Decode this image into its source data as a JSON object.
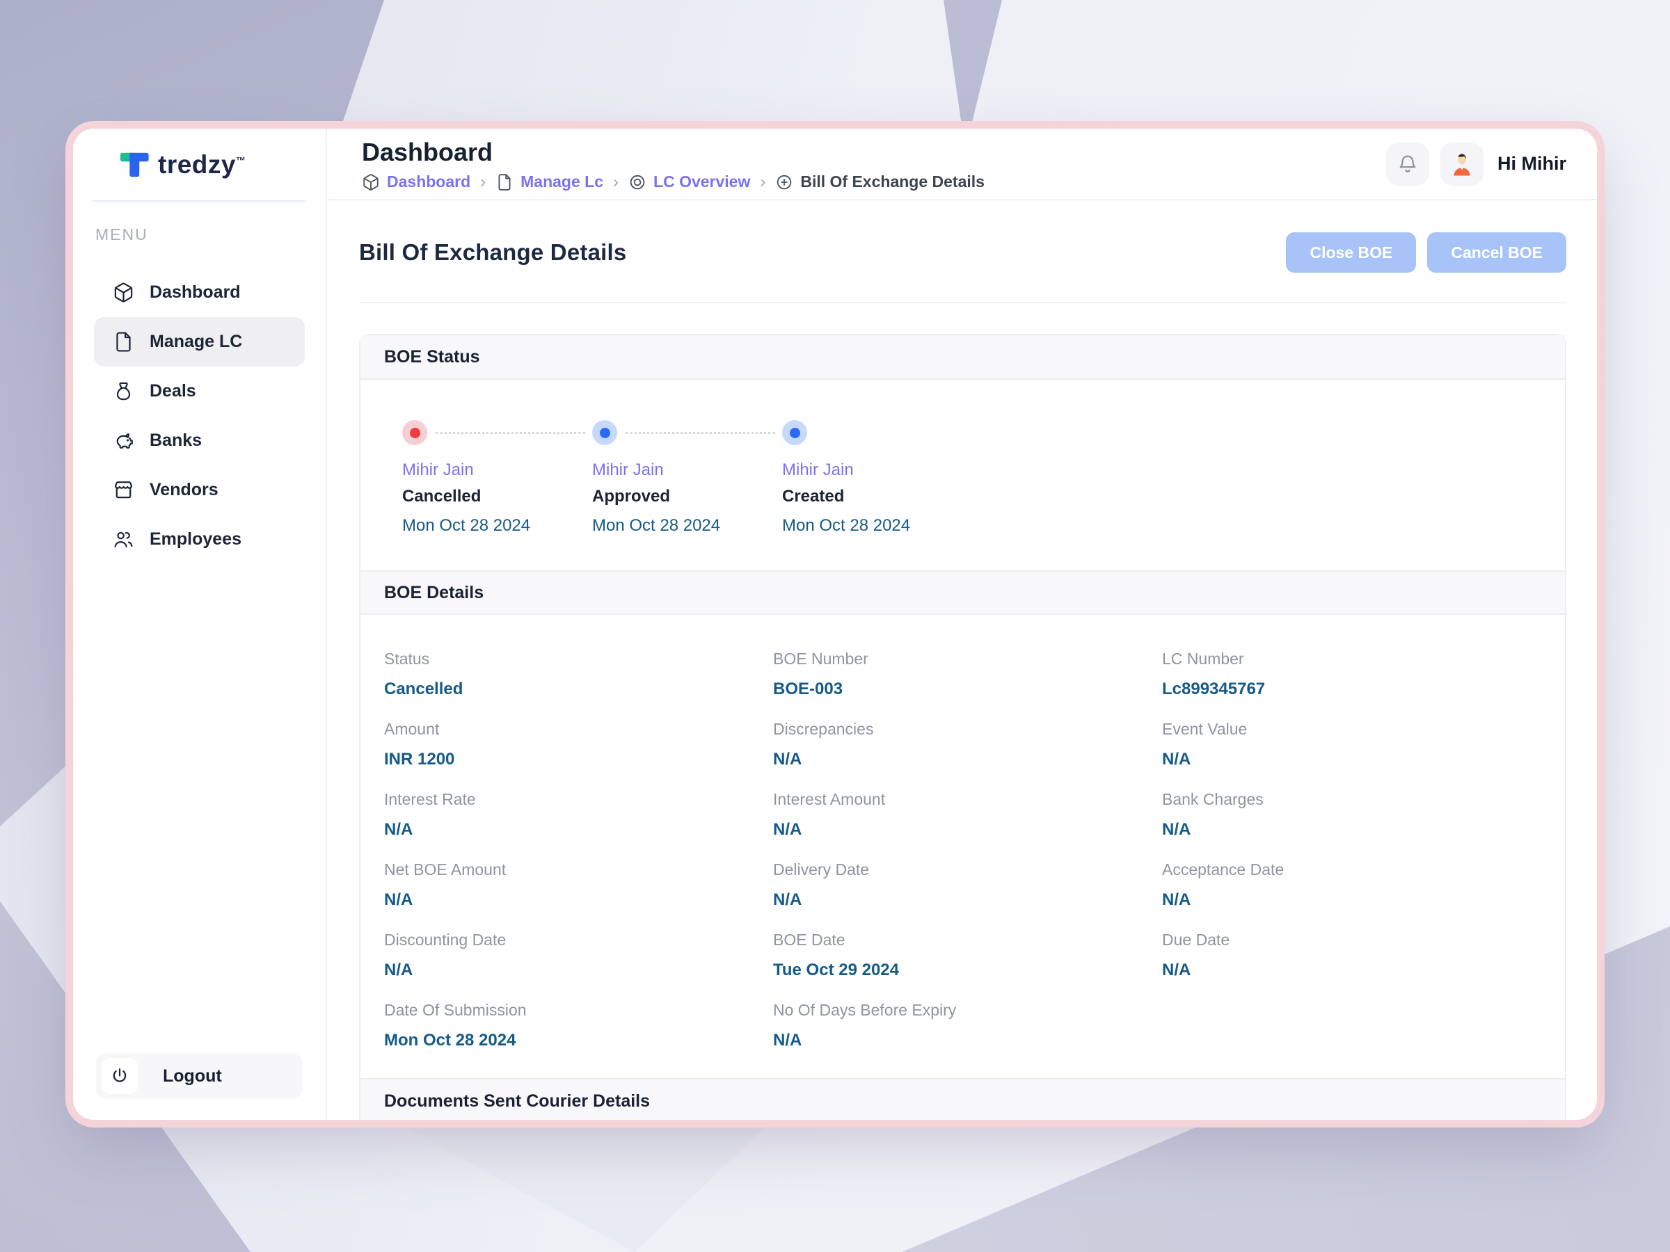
{
  "brand": {
    "name": "tredzy",
    "tm": "™"
  },
  "topbar": {
    "title": "Dashboard",
    "greeting": "Hi Mihir"
  },
  "breadcrumb": {
    "separator": "›",
    "items": [
      {
        "label": "Dashboard",
        "icon": "cube-icon"
      },
      {
        "label": "Manage Lc",
        "icon": "file-icon"
      },
      {
        "label": "LC Overview",
        "icon": "target-icon"
      },
      {
        "label": "Bill Of Exchange Details",
        "icon": "plus-circle-icon"
      }
    ]
  },
  "sidebar": {
    "menu_label": "MENU",
    "items": [
      {
        "label": "Dashboard",
        "icon": "cube-icon",
        "active": false
      },
      {
        "label": "Manage LC",
        "icon": "file-icon",
        "active": true
      },
      {
        "label": "Deals",
        "icon": "money-bag-icon",
        "active": false
      },
      {
        "label": "Banks",
        "icon": "piggy-bank-icon",
        "active": false
      },
      {
        "label": "Vendors",
        "icon": "storefront-icon",
        "active": false
      },
      {
        "label": "Employees",
        "icon": "people-icon",
        "active": false
      }
    ],
    "logout_label": "Logout"
  },
  "page": {
    "title": "Bill Of Exchange Details",
    "close_button": "Close BOE",
    "cancel_button": "Cancel BOE"
  },
  "boe_status": {
    "section_title": "BOE Status",
    "steps": [
      {
        "name": "Mihir Jain",
        "status": "Cancelled",
        "date": "Mon Oct 28 2024",
        "dot_color": "#ee3a41"
      },
      {
        "name": "Mihir Jain",
        "status": "Approved",
        "date": "Mon Oct 28 2024",
        "dot_color": "#2b6cf3"
      },
      {
        "name": "Mihir Jain",
        "status": "Created",
        "date": "Mon Oct 28 2024",
        "dot_color": "#2b6cf3"
      }
    ]
  },
  "boe_details": {
    "section_title": "BOE Details",
    "fields": [
      {
        "label": "Status",
        "value": "Cancelled"
      },
      {
        "label": "BOE Number",
        "value": "BOE-003"
      },
      {
        "label": "LC Number",
        "value": "Lc899345767"
      },
      {
        "label": "Amount",
        "value": "INR 1200"
      },
      {
        "label": "Discrepancies",
        "value": "N/A"
      },
      {
        "label": "Event Value",
        "value": "N/A"
      },
      {
        "label": "Interest Rate",
        "value": "N/A"
      },
      {
        "label": "Interest Amount",
        "value": "N/A"
      },
      {
        "label": "Bank Charges",
        "value": "N/A"
      },
      {
        "label": "Net BOE Amount",
        "value": "N/A"
      },
      {
        "label": "Delivery Date",
        "value": "N/A"
      },
      {
        "label": "Acceptance Date",
        "value": "N/A"
      },
      {
        "label": "Discounting Date",
        "value": "N/A"
      },
      {
        "label": "BOE Date",
        "value": "Tue Oct 29 2024"
      },
      {
        "label": "Due Date",
        "value": "N/A"
      },
      {
        "label": "Date Of Submission",
        "value": "Mon Oct 28 2024"
      },
      {
        "label": "No Of Days Before Expiry",
        "value": "N/A"
      }
    ]
  },
  "courier": {
    "section_title": "Documents Sent Courier Details"
  },
  "colors": {
    "accent_link": "#7a72f3",
    "value_text": "#155a88",
    "cancelled_dot": "#ee3a41",
    "active_dot": "#2b6cf3",
    "action_button": "#a7c3f8",
    "card_ring": "#f5d4d9"
  }
}
